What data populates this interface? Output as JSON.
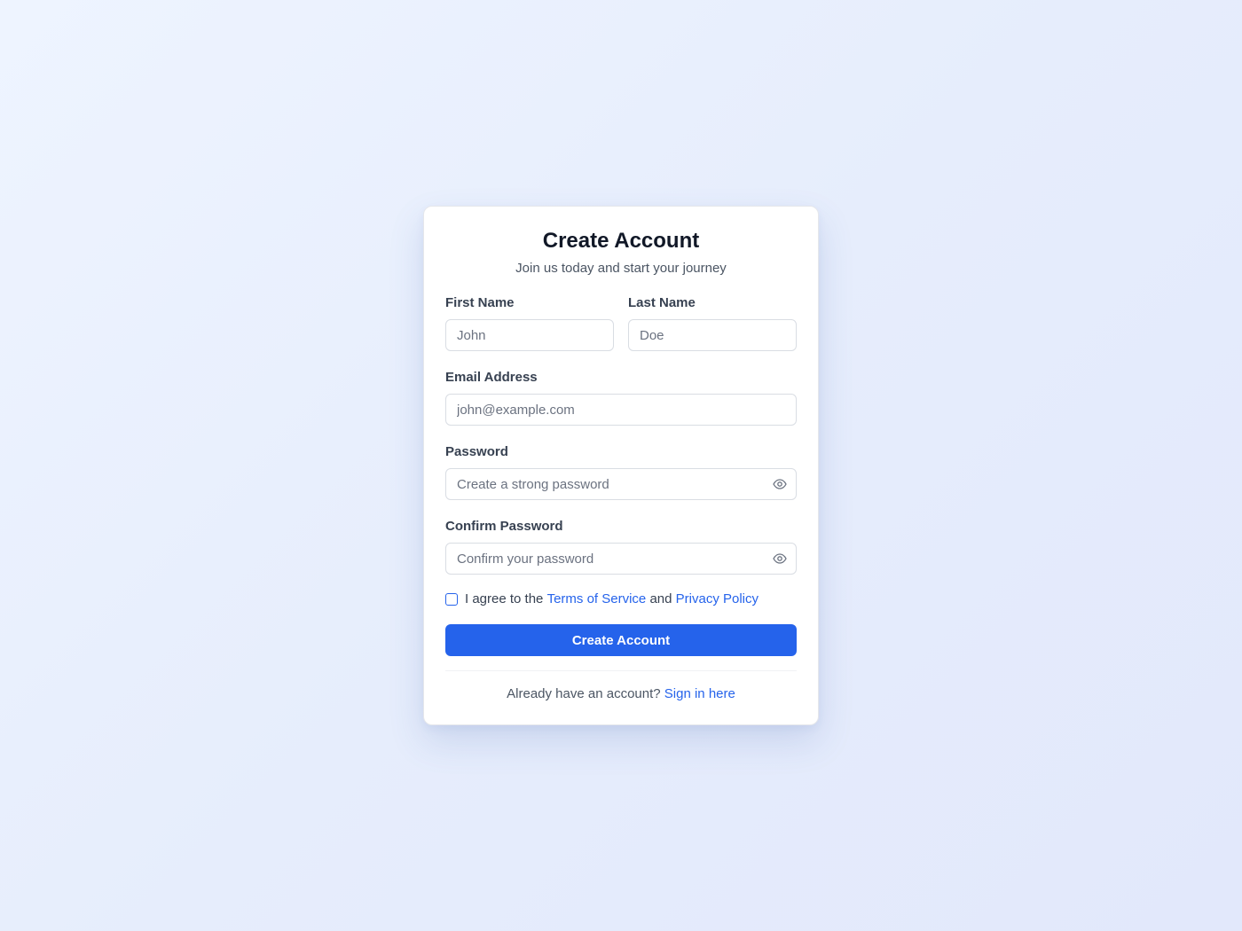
{
  "form": {
    "title": "Create Account",
    "subtitle": "Join us today and start your journey",
    "first_name": {
      "label": "First Name",
      "placeholder": "John",
      "value": ""
    },
    "last_name": {
      "label": "Last Name",
      "placeholder": "Doe",
      "value": ""
    },
    "email": {
      "label": "Email Address",
      "placeholder": "john@example.com",
      "value": ""
    },
    "password": {
      "label": "Password",
      "placeholder": "Create a strong password",
      "value": "",
      "toggle_icon": "eye-icon"
    },
    "confirm_password": {
      "label": "Confirm Password",
      "placeholder": "Confirm your password",
      "value": "",
      "toggle_icon": "eye-icon"
    },
    "agree": {
      "checked": false,
      "prefix": "I agree to the",
      "terms_link": "Terms of Service",
      "joiner": "and",
      "privacy_link": "Privacy Policy"
    },
    "submit_label": "Create Account",
    "footer": {
      "text": "Already have an account?",
      "link": "Sign in here"
    }
  },
  "colors": {
    "accent": "#2563eb",
    "background": "#e8eefc",
    "card": "#ffffff",
    "text_primary": "#111827",
    "text_secondary": "#4b5563"
  }
}
